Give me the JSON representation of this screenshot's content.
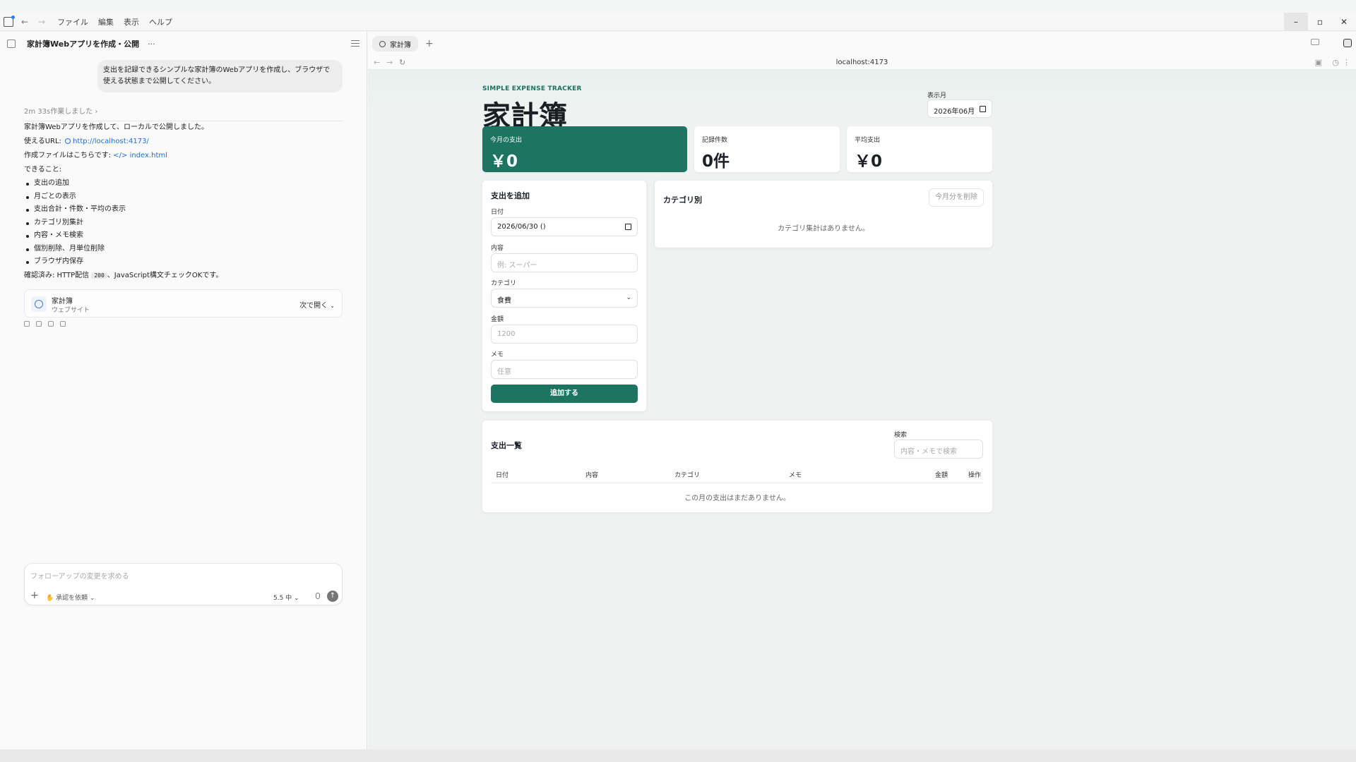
{
  "menu": [
    "ファイル",
    "編集",
    "表示",
    "ヘルプ"
  ],
  "window_controls": {
    "minimize": "–",
    "restore": "▫",
    "close": "✕"
  },
  "chat": {
    "title": "家計簿Webアプリを作成・公開",
    "more": "···",
    "user_message": "支出を記録できるシンプルな家計簿のWebアプリを作成し、ブラウザで使える状態まで公開してください。",
    "worked": "2m 33s作業しました",
    "worked_chevron": "›",
    "response": {
      "line1": "家計簿Webアプリを作成して、ローカルで公開しました。",
      "url_label": "使えるURL: ",
      "url": "http://localhost:4173/",
      "file_label": "作成ファイルはこちらです: ",
      "file": "index.html",
      "can_do": "できること:",
      "features": [
        "支出の追加",
        "月ごとの表示",
        "支出合計・件数・平均の表示",
        "カテゴリ別集計",
        "内容・メモ検索",
        "個別削除、月単位削除",
        "ブラウザ内保存"
      ],
      "confirm_pre": "確認済み: HTTP配信 ",
      "confirm_code": "200",
      "confirm_post": "、JavaScript構文チェックOKです。"
    },
    "site_card": {
      "title": "家計簿",
      "subtitle": "ウェブサイト",
      "open": "次で開く"
    },
    "composer": {
      "placeholder": "フォローアップの変更を求める",
      "approval": "承認を依頼",
      "model": "5.5 中"
    }
  },
  "browser": {
    "tab_title": "家計簿",
    "url": "localhost:4173"
  },
  "app": {
    "tag": "SIMPLE EXPENSE TRACKER",
    "title": "家計簿",
    "month_label": "表示月",
    "month_value": "2026年06月",
    "stats": [
      {
        "label": "今月の支出",
        "value": "￥0"
      },
      {
        "label": "記録件数",
        "value": "0件"
      },
      {
        "label": "平均支出",
        "value": "￥0"
      }
    ],
    "form": {
      "title": "支出を追加",
      "date_label": "日付",
      "date_value": "2026/06/30 ()",
      "content_label": "内容",
      "content_placeholder": "例: スーパー",
      "category_label": "カテゴリ",
      "category_value": "食費",
      "amount_label": "金額",
      "amount_placeholder": "1200",
      "memo_label": "メモ",
      "memo_placeholder": "任意",
      "submit": "追加する"
    },
    "category": {
      "title": "カテゴリ別",
      "delete_month": "今月分を削除",
      "empty": "カテゴリ集計はありません。"
    },
    "list": {
      "title": "支出一覧",
      "search_label": "検索",
      "search_placeholder": "内容・メモで検索",
      "columns": [
        "日付",
        "内容",
        "カテゴリ",
        "メモ",
        "金額",
        "操作"
      ],
      "empty": "この月の支出はまだありません。"
    }
  }
}
